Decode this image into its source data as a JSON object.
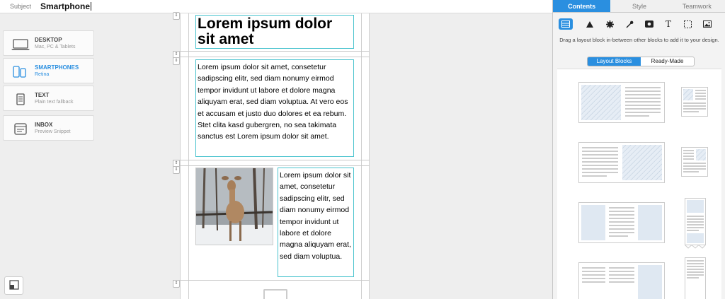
{
  "subject": {
    "label": "Subject",
    "value": "Smartphone"
  },
  "devices": [
    {
      "title": "DESKTOP",
      "subtitle": "Mac, PC & Tablets",
      "icon": "laptop-icon",
      "active": false
    },
    {
      "title": "SMARTPHONES",
      "subtitle": "Retina",
      "icon": "smartphones-icon",
      "active": true
    },
    {
      "title": "TEXT",
      "subtitle": "Plain text fallback",
      "icon": "document-icon",
      "active": false
    },
    {
      "title": "INBOX",
      "subtitle": "Preview Snippet",
      "icon": "inbox-icon",
      "active": false
    }
  ],
  "content": {
    "heading": "Lorem ipsum dolor sit amet",
    "paragraph": "Lorem ipsum dolor sit amet, consetetur sadipscing elitr, sed diam nonumy eirmod tempor invidunt ut labore et dolore magna aliquyam erat, sed diam voluptua. At vero eos et accusam et justo duo dolores et ea rebum. Stet clita kasd gubergren, no sea takimata sanctus est Lorem ipsum dolor sit amet.",
    "side_text": "Lorem ipsum dolor sit amet, consetetur sadipscing elitr, sed diam nonumy eirmod tempor invidunt ut labore et dolore magna aliquyam erat, sed diam voluptua.",
    "handle_glyph": "⇕"
  },
  "panel": {
    "tabs": [
      "Contents",
      "Style",
      "Teamwork"
    ],
    "active_tab": "Contents",
    "tool_icons": [
      "layout-block-icon",
      "triangle-icon",
      "gear-badge-icon",
      "eyedropper-icon",
      "video-icon",
      "text-tool-icon",
      "dashed-selection-icon",
      "image-icon"
    ],
    "text_tool_glyph": "T",
    "hint": "Drag a layout block in-between other blocks to add it to your design.",
    "segments": [
      "Layout Blocks",
      "Ready-Made"
    ],
    "active_segment": "Layout Blocks"
  },
  "colors": {
    "accent": "#2a8fe0",
    "selection": "#49c3ce",
    "hatch": "#cfdbe8"
  }
}
